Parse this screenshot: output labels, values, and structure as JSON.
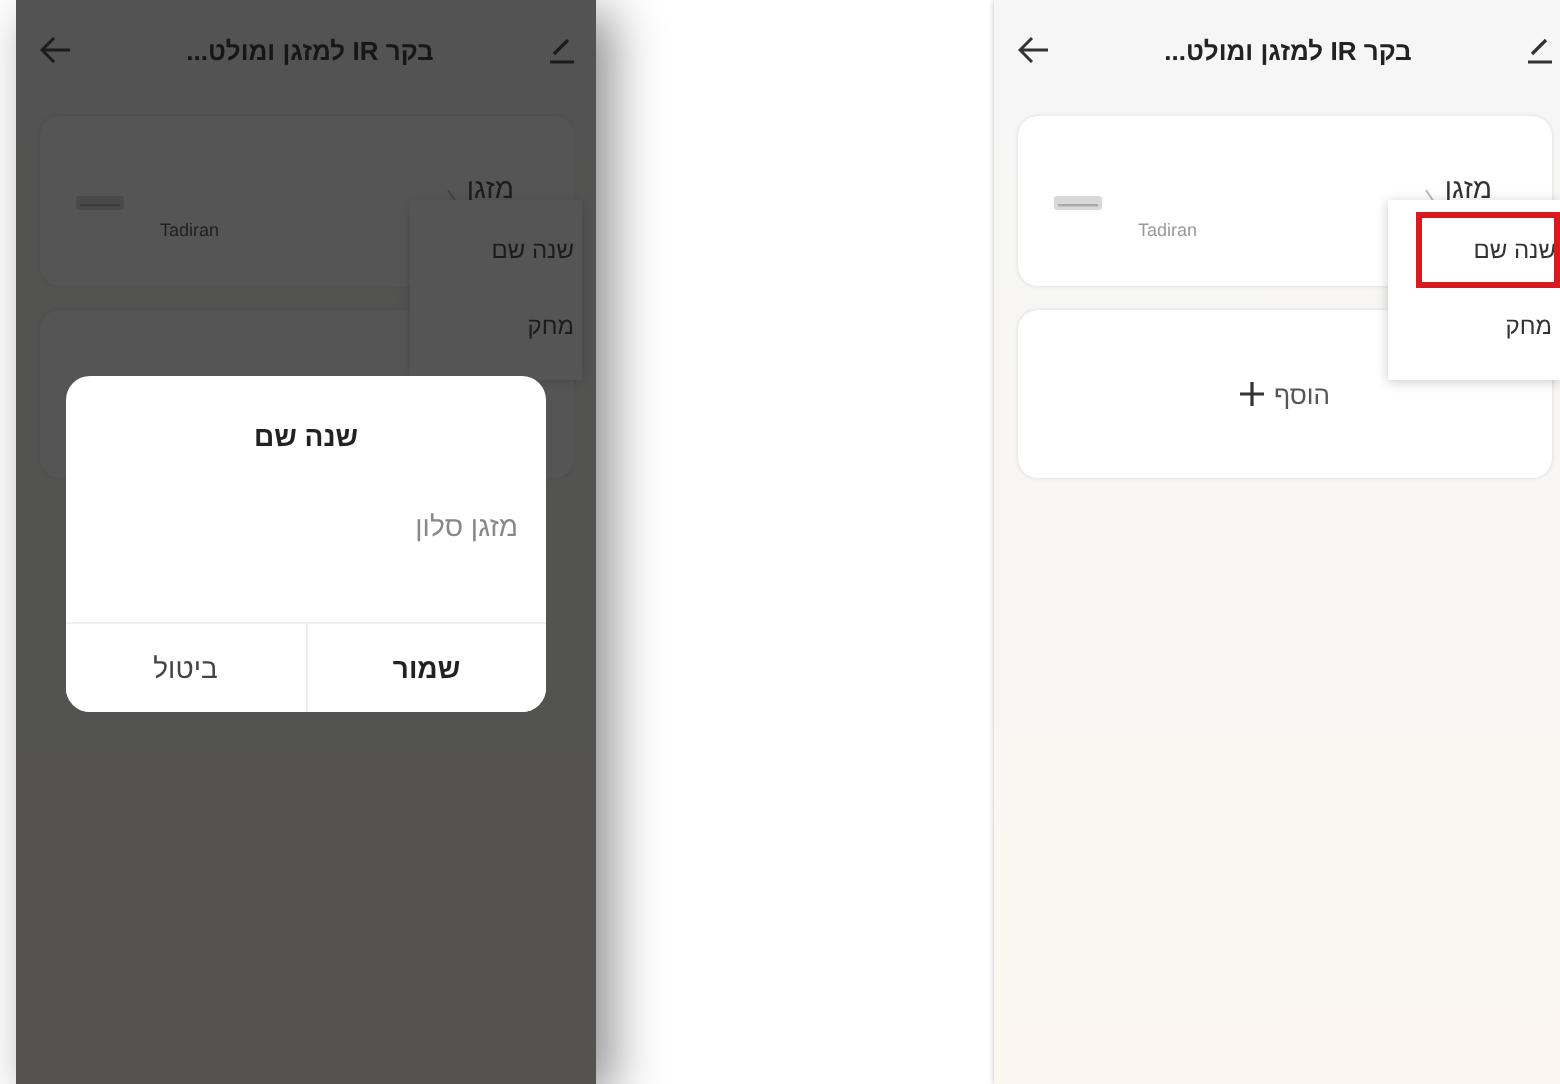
{
  "screens": [
    {
      "title": "בקר IR למזגן ומולט...",
      "device": {
        "name": "מזגן",
        "brand": "Tadiran"
      },
      "menu": [
        {
          "label": "שנה שם",
          "highlighted": true
        },
        {
          "label": "מחק",
          "highlighted": false
        }
      ],
      "add_label": "הוסף"
    },
    {
      "title": "בקר IR למזגן ומולט...",
      "device": {
        "name": "מזגן",
        "brand": "Tadiran"
      },
      "menu": [
        {
          "label": "שנה שם",
          "highlighted": false
        },
        {
          "label": "מחק",
          "highlighted": false
        }
      ],
      "dialog": {
        "title": "שנה שם",
        "value": "מזגן סלון",
        "buttons": [
          {
            "label": "שמור",
            "kind": "primary"
          },
          {
            "label": "ביטול",
            "kind": "secondary"
          }
        ]
      }
    }
  ]
}
